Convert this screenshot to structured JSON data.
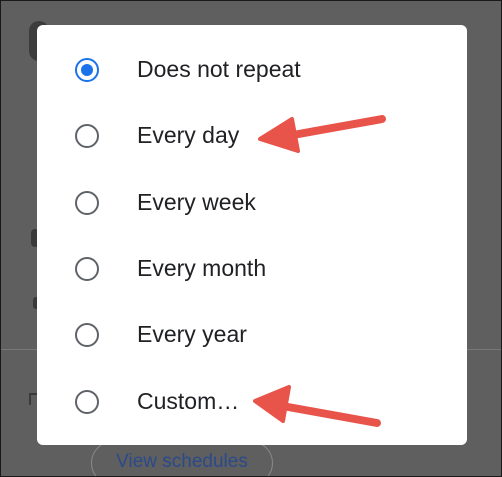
{
  "dialog": {
    "options": [
      {
        "label": "Does not repeat",
        "selected": true
      },
      {
        "label": "Every day",
        "selected": false
      },
      {
        "label": "Every week",
        "selected": false
      },
      {
        "label": "Every month",
        "selected": false
      },
      {
        "label": "Every year",
        "selected": false
      },
      {
        "label": "Custom…",
        "selected": false
      }
    ]
  },
  "background": {
    "button_label": "View schedules"
  },
  "colors": {
    "accent": "#1a73e8",
    "radio_unselected": "#5f6368",
    "annotation_arrow": "#e8534a",
    "scrim": "#5f5f5f"
  },
  "annotations": [
    {
      "name": "arrow-every-day",
      "points_to": "Every day",
      "icon": "arrow-left-icon"
    },
    {
      "name": "arrow-custom",
      "points_to": "Custom…",
      "icon": "arrow-left-icon"
    }
  ]
}
